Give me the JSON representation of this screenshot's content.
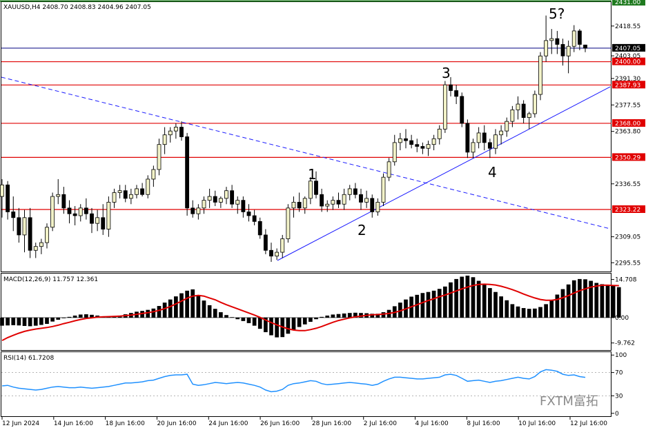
{
  "header": {
    "symbol_text": "XAUUSD,H4  2408.70 2408.83 2404.96 2407.05",
    "macd_text": "MACD(12,26,9) 11.757 12.361",
    "rsi_text": "RSI(14) 61.7208"
  },
  "watermark": "FXTM富拓",
  "colors": {
    "background": "#ffffff",
    "bull_candle": "#f2f2c8",
    "bear_candle": "#000000",
    "support_line": "#e00000",
    "trend_line": "#1a1aff",
    "current_price_line": "#000080",
    "macd_signal": "#e00000",
    "macd_hist": "#000000",
    "rsi_line": "#1e90ff",
    "top_border": "#1f7a1f"
  },
  "chart_data": [
    {
      "type": "candlestick",
      "title": "XAUUSD,H4",
      "current_price": 2407.05,
      "top_price": 2431.0,
      "y_ticks": [
        2418.55,
        2403.05,
        2391.3,
        2377.55,
        2363.8,
        2336.55,
        2309.05,
        2295.55
      ],
      "levels": [
        2400.0,
        2387.93,
        2368.0,
        2350.29,
        2323.22
      ],
      "x_ticks": [
        "12 Jun 2024",
        "14 Jun 16:00",
        "18 Jun 16:00",
        "20 Jun 16:00",
        "24 Jun 16:00",
        "26 Jun 16:00",
        "28 Jun 16:00",
        "2 Jul 16:00",
        "4 Jul 16:00",
        "8 Jul 16:00",
        "10 Jul 16:00",
        "12 Jul 16:00"
      ],
      "wave_labels": [
        "1",
        "2",
        "3",
        "4",
        "5?"
      ],
      "ohlc": [
        [
          2330,
          2339,
          2319,
          2336
        ],
        [
          2336,
          2338,
          2318,
          2322
        ],
        [
          2322,
          2330,
          2312,
          2319
        ],
        [
          2319,
          2324,
          2306,
          2310
        ],
        [
          2310,
          2323,
          2301,
          2319
        ],
        [
          2319,
          2324,
          2298,
          2302
        ],
        [
          2302,
          2306,
          2298,
          2304
        ],
        [
          2304,
          2308,
          2300,
          2306
        ],
        [
          2306,
          2316,
          2303,
          2314
        ],
        [
          2314,
          2332,
          2312,
          2330
        ],
        [
          2330,
          2339,
          2326,
          2331
        ],
        [
          2331,
          2335,
          2321,
          2324
        ],
        [
          2324,
          2328,
          2316,
          2321
        ],
        [
          2321,
          2325,
          2315,
          2320
        ],
        [
          2320,
          2326,
          2317,
          2324
        ],
        [
          2324,
          2329,
          2318,
          2321
        ],
        [
          2321,
          2324,
          2311,
          2316
        ],
        [
          2316,
          2323,
          2312,
          2319
        ],
        [
          2319,
          2326,
          2310,
          2313
        ],
        [
          2313,
          2330,
          2309,
          2327
        ],
        [
          2327,
          2334,
          2324,
          2332
        ],
        [
          2332,
          2336,
          2329,
          2333
        ],
        [
          2333,
          2336,
          2327,
          2329
        ],
        [
          2329,
          2334,
          2326,
          2331
        ],
        [
          2331,
          2336,
          2329,
          2334
        ],
        [
          2334,
          2337,
          2330,
          2331
        ],
        [
          2331,
          2341,
          2329,
          2339
        ],
        [
          2339,
          2346,
          2335,
          2344
        ],
        [
          2344,
          2360,
          2341,
          2357
        ],
        [
          2357,
          2366,
          2352,
          2362
        ],
        [
          2362,
          2366,
          2358,
          2364
        ],
        [
          2364,
          2368,
          2360,
          2366
        ],
        [
          2366,
          2369,
          2359,
          2361
        ],
        [
          2361,
          2363,
          2320,
          2324
        ],
        [
          2324,
          2328,
          2319,
          2321
        ],
        [
          2321,
          2326,
          2318,
          2324
        ],
        [
          2324,
          2330,
          2321,
          2328
        ],
        [
          2328,
          2334,
          2324,
          2330
        ],
        [
          2330,
          2333,
          2325,
          2327
        ],
        [
          2327,
          2330,
          2324,
          2329
        ],
        [
          2329,
          2335,
          2326,
          2333
        ],
        [
          2333,
          2336,
          2324,
          2326
        ],
        [
          2326,
          2330,
          2321,
          2328
        ],
        [
          2328,
          2330,
          2319,
          2322
        ],
        [
          2322,
          2326,
          2317,
          2320
        ],
        [
          2320,
          2323,
          2315,
          2317
        ],
        [
          2317,
          2319,
          2308,
          2310
        ],
        [
          2310,
          2313,
          2300,
          2302
        ],
        [
          2302,
          2306,
          2296,
          2299
        ],
        [
          2299,
          2303,
          2297,
          2301
        ],
        [
          2301,
          2310,
          2298,
          2308
        ],
        [
          2308,
          2326,
          2306,
          2324
        ],
        [
          2324,
          2330,
          2319,
          2327
        ],
        [
          2327,
          2332,
          2322,
          2324
        ],
        [
          2324,
          2330,
          2321,
          2329
        ],
        [
          2329,
          2340,
          2326,
          2338
        ],
        [
          2338,
          2343,
          2329,
          2331
        ],
        [
          2331,
          2334,
          2322,
          2325
        ],
        [
          2325,
          2328,
          2322,
          2326
        ],
        [
          2326,
          2330,
          2323,
          2328
        ],
        [
          2328,
          2332,
          2324,
          2326
        ],
        [
          2326,
          2334,
          2323,
          2331
        ],
        [
          2331,
          2336,
          2328,
          2334
        ],
        [
          2334,
          2337,
          2329,
          2331
        ],
        [
          2331,
          2334,
          2323,
          2327
        ],
        [
          2327,
          2333,
          2324,
          2329
        ],
        [
          2329,
          2331,
          2319,
          2322
        ],
        [
          2322,
          2329,
          2320,
          2327
        ],
        [
          2327,
          2342,
          2325,
          2340
        ],
        [
          2340,
          2350,
          2338,
          2348
        ],
        [
          2348,
          2362,
          2346,
          2358
        ],
        [
          2358,
          2363,
          2354,
          2360
        ],
        [
          2360,
          2365,
          2355,
          2359
        ],
        [
          2359,
          2362,
          2355,
          2357
        ],
        [
          2357,
          2360,
          2353,
          2356
        ],
        [
          2356,
          2358,
          2352,
          2355
        ],
        [
          2355,
          2359,
          2351,
          2357
        ],
        [
          2357,
          2362,
          2354,
          2360
        ],
        [
          2360,
          2367,
          2357,
          2365
        ],
        [
          2365,
          2390,
          2363,
          2388
        ],
        [
          2388,
          2392,
          2382,
          2385
        ],
        [
          2385,
          2388,
          2378,
          2382
        ],
        [
          2382,
          2384,
          2366,
          2368
        ],
        [
          2368,
          2370,
          2350,
          2353
        ],
        [
          2353,
          2360,
          2350,
          2358
        ],
        [
          2358,
          2366,
          2355,
          2363
        ],
        [
          2363,
          2367,
          2354,
          2358
        ],
        [
          2358,
          2360,
          2350,
          2355
        ],
        [
          2355,
          2365,
          2352,
          2362
        ],
        [
          2362,
          2367,
          2357,
          2364
        ],
        [
          2364,
          2371,
          2361,
          2369
        ],
        [
          2369,
          2377,
          2366,
          2375
        ],
        [
          2375,
          2382,
          2370,
          2378
        ],
        [
          2378,
          2380,
          2368,
          2371
        ],
        [
          2371,
          2374,
          2365,
          2373
        ],
        [
          2373,
          2385,
          2371,
          2383
        ],
        [
          2383,
          2405,
          2380,
          2403
        ],
        [
          2403,
          2424,
          2400,
          2411
        ],
        [
          2411,
          2417,
          2404,
          2412
        ],
        [
          2412,
          2416,
          2404,
          2409
        ],
        [
          2409,
          2412,
          2398,
          2403
        ],
        [
          2403,
          2411,
          2394,
          2408
        ],
        [
          2408,
          2419,
          2405,
          2416
        ],
        [
          2416,
          2417,
          2406,
          2409
        ],
        [
          2408.7,
          2408.83,
          2404.96,
          2407.05
        ]
      ]
    },
    {
      "type": "bar",
      "title": "MACD(12,26,9) 11.757 12.361",
      "series_names": [
        "MACD",
        "Signal"
      ],
      "y_ticks": [
        14.708,
        0.0,
        -9.762
      ],
      "macd": [
        -3.1,
        -3.0,
        -2.9,
        -3.0,
        -3.2,
        -3.3,
        -3.1,
        -2.8,
        -2.4,
        -1.5,
        -0.8,
        -0.2,
        0.3,
        0.8,
        1.2,
        1.3,
        1.1,
        0.8,
        0.5,
        0.3,
        0.4,
        0.8,
        1.3,
        1.8,
        2.3,
        2.6,
        3.0,
        3.5,
        4.5,
        5.8,
        7.0,
        8.2,
        9.4,
        10.4,
        10.9,
        8.6,
        6.6,
        4.8,
        3.4,
        2.1,
        1.0,
        0.2,
        -0.6,
        -1.3,
        -2.1,
        -3.1,
        -4.3,
        -5.6,
        -6.8,
        -7.6,
        -7.5,
        -6.2,
        -4.9,
        -3.6,
        -2.6,
        -1.6,
        -0.6,
        0.3,
        0.8,
        1.2,
        1.4,
        1.6,
        1.8,
        1.9,
        1.8,
        1.7,
        1.5,
        1.5,
        2.1,
        3.0,
        4.4,
        5.8,
        7.0,
        8.1,
        8.8,
        9.5,
        9.9,
        10.4,
        11.1,
        12.0,
        13.6,
        14.9,
        15.8,
        16.2,
        15.6,
        14.2,
        12.8,
        11.4,
        9.9,
        8.2,
        6.7,
        5.2,
        4.3,
        3.7,
        3.4,
        3.5,
        4.1,
        5.2,
        6.9,
        8.9,
        11.0,
        12.8,
        14.4,
        14.9,
        14.8,
        14.2,
        13.4,
        12.9,
        12.6,
        12.3,
        11.757
      ],
      "signal": [
        -8.8,
        -7.7,
        -6.8,
        -6.0,
        -5.3,
        -4.8,
        -4.4,
        -4.1,
        -3.8,
        -3.4,
        -2.9,
        -2.3,
        -1.8,
        -1.2,
        -0.7,
        -0.3,
        -0.1,
        0.2,
        0.3,
        0.4,
        0.5,
        0.6,
        0.8,
        1.0,
        1.3,
        1.6,
        1.9,
        2.3,
        2.8,
        3.5,
        4.3,
        5.3,
        6.4,
        7.5,
        8.3,
        8.6,
        8.3,
        7.6,
        6.9,
        5.9,
        5.0,
        4.2,
        3.4,
        2.6,
        1.8,
        1.0,
        0.1,
        -0.9,
        -1.9,
        -2.8,
        -3.6,
        -4.3,
        -4.8,
        -5.0,
        -5.0,
        -4.6,
        -4.1,
        -3.4,
        -2.6,
        -1.8,
        -1.1,
        -0.6,
        -0.1,
        0.3,
        0.6,
        0.9,
        1.1,
        1.2,
        1.4,
        1.6,
        2.0,
        2.6,
        3.4,
        4.2,
        5.0,
        5.8,
        6.6,
        7.3,
        8.1,
        8.7,
        9.5,
        10.3,
        11.1,
        11.8,
        12.4,
        12.8,
        12.9,
        12.8,
        12.6,
        12.1,
        11.5,
        10.8,
        10.0,
        9.1,
        8.3,
        7.6,
        7.0,
        6.7,
        6.7,
        7.0,
        7.7,
        8.5,
        9.5,
        10.4,
        11.1,
        11.8,
        12.2,
        12.5,
        12.5,
        12.4,
        12.361
      ]
    },
    {
      "type": "line",
      "title": "RSI(14) 61.7208",
      "series_names": [
        "RSI(14)"
      ],
      "y_ticks": [
        100,
        70,
        30,
        0
      ],
      "values": [
        47,
        48,
        45,
        43,
        42,
        41,
        40,
        41,
        43,
        45,
        46,
        45,
        44,
        44,
        45,
        44,
        43,
        44,
        45,
        46,
        48,
        50,
        52,
        52,
        53,
        54,
        56,
        57,
        60,
        63,
        65,
        66,
        66,
        67,
        50,
        48,
        49,
        51,
        53,
        52,
        51,
        52,
        53,
        52,
        50,
        48,
        45,
        40,
        37,
        38,
        41,
        48,
        51,
        52,
        54,
        56,
        55,
        51,
        49,
        50,
        51,
        52,
        53,
        52,
        51,
        50,
        48,
        50,
        55,
        59,
        62,
        62,
        61,
        60,
        59,
        59,
        60,
        61,
        62,
        66,
        67,
        65,
        60,
        55,
        56,
        57,
        55,
        53,
        55,
        56,
        58,
        60,
        62,
        60,
        59,
        63,
        71,
        75,
        74,
        72,
        67,
        65,
        66,
        63,
        61.7208
      ]
    }
  ]
}
